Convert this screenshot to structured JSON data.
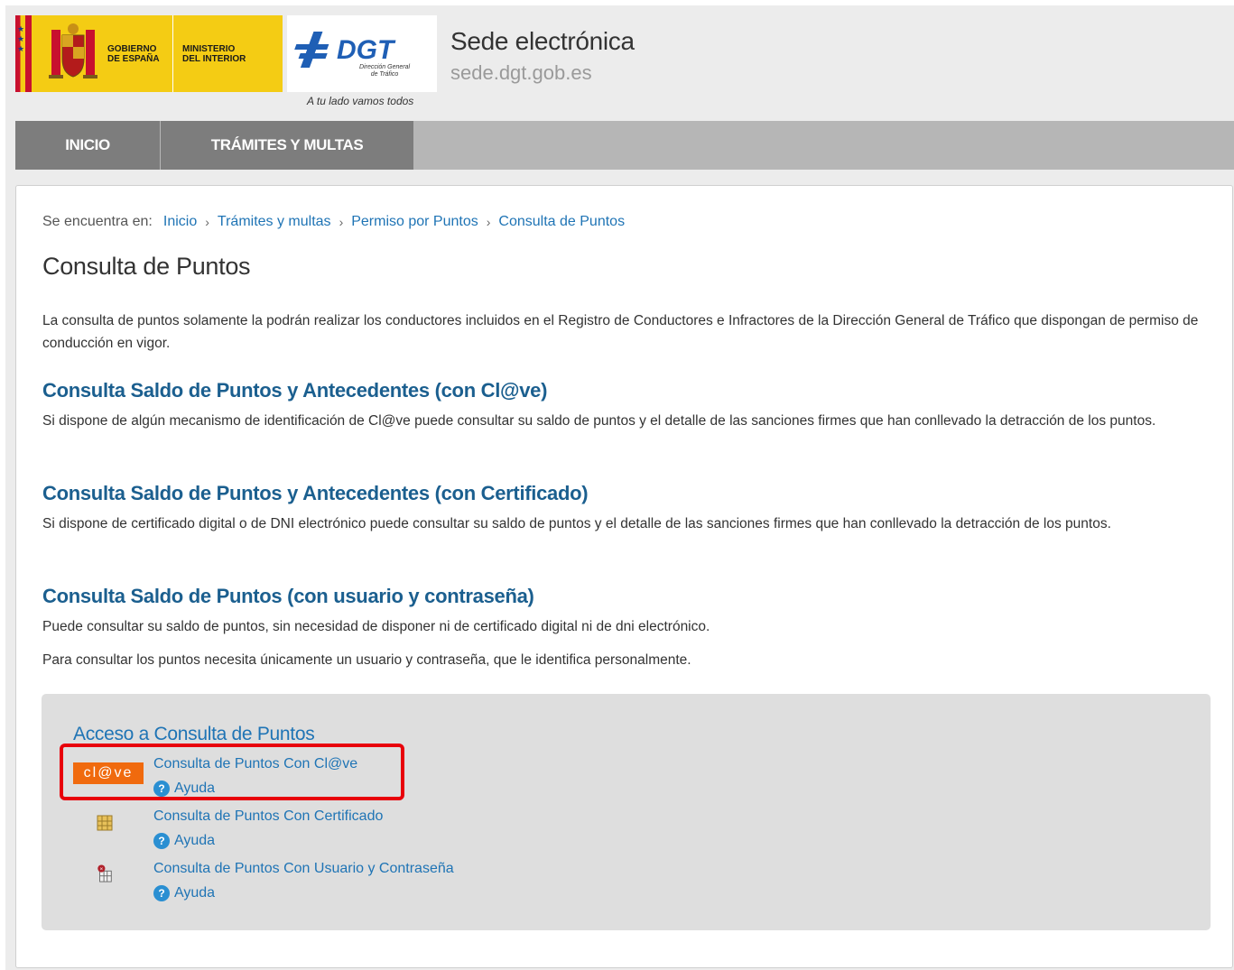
{
  "header": {
    "gov_line1": "GOBIERNO",
    "gov_line2": "DE ESPAÑA",
    "ministry_line1": "MINISTERIO",
    "ministry_line2": "DEL INTERIOR",
    "dgt_logo_text": "DGT",
    "dgt_sub1": "Dirección General",
    "dgt_sub2": "de Tráfico",
    "tagline": "A tu lado vamos todos",
    "site_title": "Sede electrónica",
    "site_url": "sede.dgt.gob.es"
  },
  "nav": {
    "items": [
      {
        "label": "INICIO"
      },
      {
        "label": "TRÁMITES Y MULTAS"
      }
    ]
  },
  "breadcrumb": {
    "lead": "Se encuentra en:",
    "items": [
      "Inicio",
      "Trámites y multas",
      "Permiso por Puntos",
      "Consulta de Puntos"
    ]
  },
  "page": {
    "title": "Consulta de Puntos",
    "intro": "La consulta de puntos solamente la podrán realizar los conductores incluidos en el Registro de Conductores e Infractores de la Dirección General de Tráfico que dispongan de permiso de conducción en vigor."
  },
  "sections": [
    {
      "title": "Consulta Saldo de Puntos y Antecedentes (con Cl@ve)",
      "text": "Si dispone de algún mecanismo de identificación de Cl@ve puede consultar su saldo de puntos y el detalle de las sanciones firmes que han conllevado la detracción de los puntos."
    },
    {
      "title": "Consulta Saldo de Puntos y Antecedentes (con Certificado)",
      "text": "Si dispone de certificado digital o de DNI electrónico puede consultar su saldo de puntos y el detalle de las sanciones firmes que han conllevado la detracción de los puntos."
    },
    {
      "title": "Consulta Saldo de Puntos (con usuario y contraseña)",
      "text": "Puede consultar su saldo de puntos, sin necesidad de disponer ni de certificado digital ni de dni electrónico.",
      "text2": "Para consultar los puntos necesita únicamente un usuario y contraseña, que le identifica personalmente."
    }
  ],
  "access": {
    "title": "Acceso a Consulta de Puntos",
    "clave_logo": "cl@ve",
    "links": [
      {
        "label": "Consulta de Puntos Con Cl@ve",
        "help": "Ayuda"
      },
      {
        "label": "Consulta de Puntos Con Certificado",
        "help": "Ayuda"
      },
      {
        "label": "Consulta de Puntos Con Usuario y Contraseña",
        "help": "Ayuda"
      }
    ]
  },
  "colors": {
    "link": "#1f74b5",
    "section_title": "#1b5f8f",
    "nav_active": "#7d7d7d",
    "clave_orange": "#f06a0e",
    "highlight_red": "#e8000b"
  }
}
